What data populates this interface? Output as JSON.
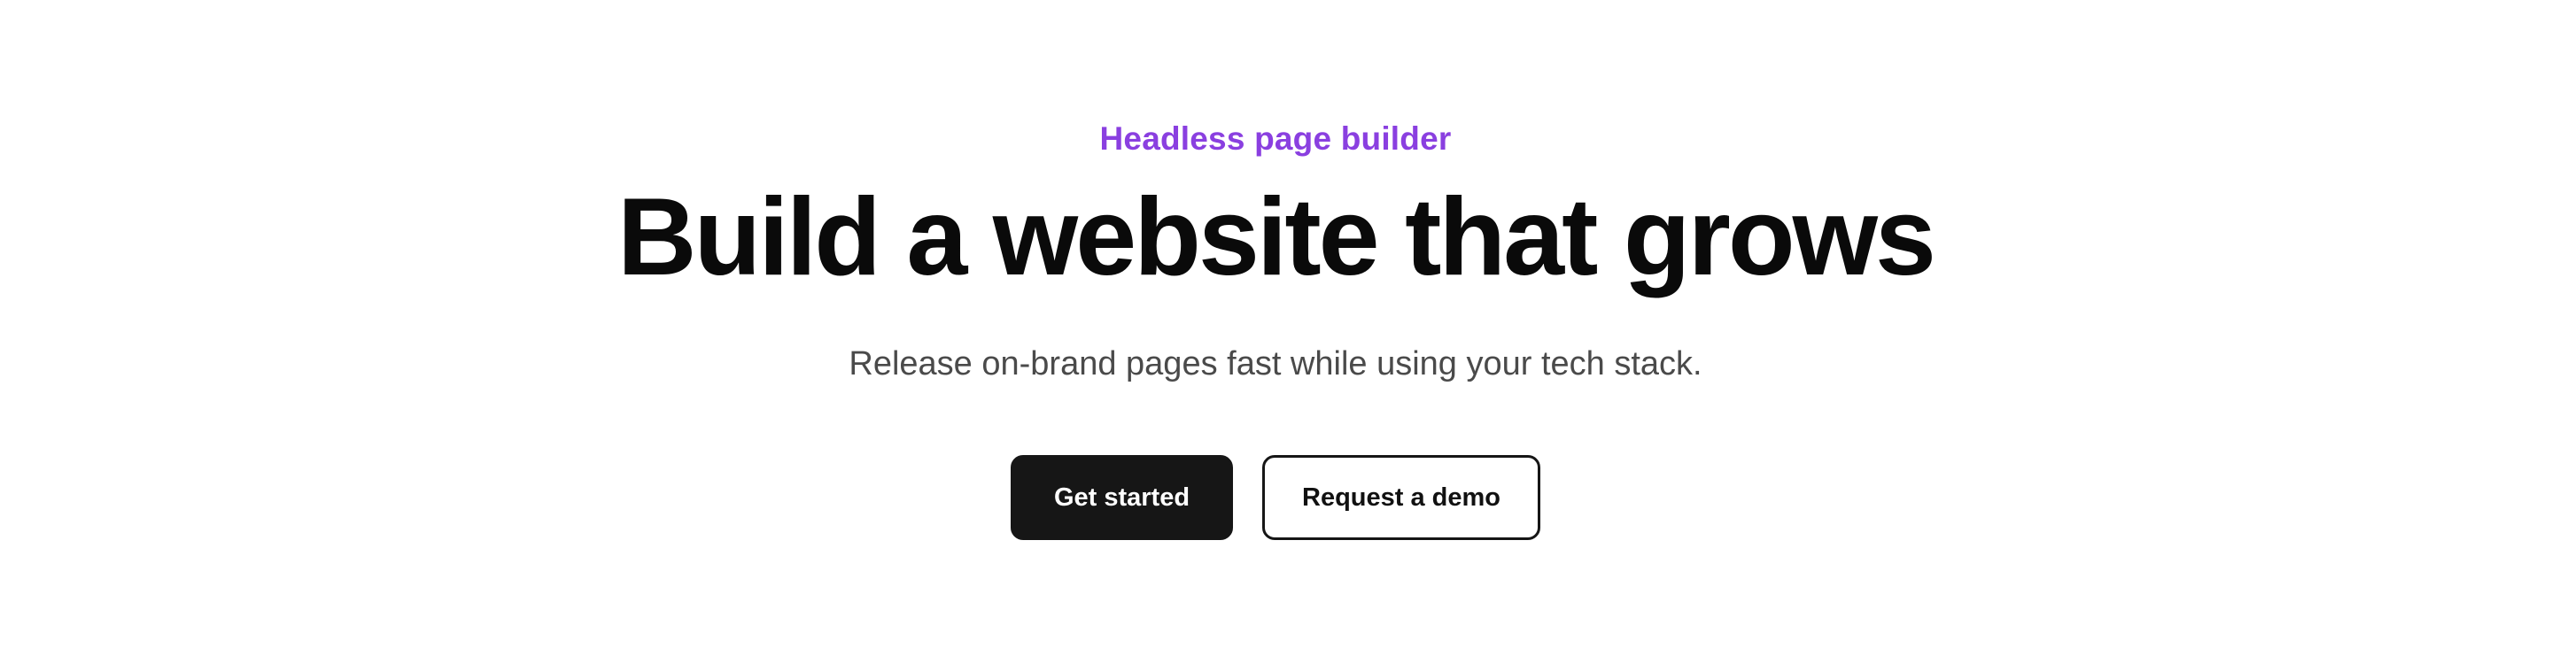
{
  "hero": {
    "eyebrow": "Headless page builder",
    "headline": "Build a website that grows",
    "subheadline": "Release on-brand pages fast while using your tech stack.",
    "primary_cta": "Get started",
    "secondary_cta": "Request a demo"
  },
  "colors": {
    "accent": "#8a3fe0",
    "headline": "#0a0a0a",
    "body_text": "#4a4a4a",
    "primary_button_bg": "#161616",
    "background": "#ffffff"
  }
}
